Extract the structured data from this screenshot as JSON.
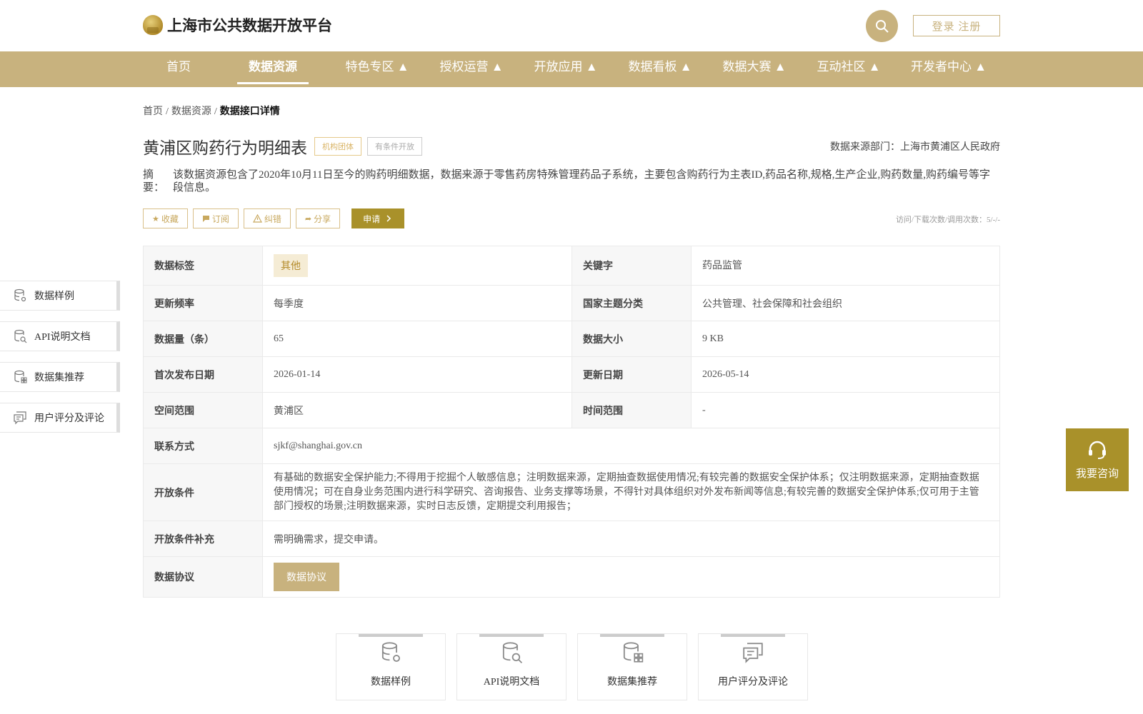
{
  "header": {
    "site_title": "上海市公共数据开放平台",
    "login_label": "登录 注册"
  },
  "nav": {
    "items": [
      {
        "label": "首页"
      },
      {
        "label": "数据资源"
      },
      {
        "label": "特色专区 ▲"
      },
      {
        "label": "授权运营 ▲"
      },
      {
        "label": "开放应用 ▲"
      },
      {
        "label": "数据看板 ▲"
      },
      {
        "label": "数据大赛 ▲"
      },
      {
        "label": "互动社区 ▲"
      },
      {
        "label": "开发者中心 ▲"
      }
    ]
  },
  "breadcrumb": {
    "home": "首页",
    "sep": "/",
    "section": "数据资源",
    "current": "数据接口详情"
  },
  "dataset": {
    "title": "黄浦区购药行为明细表",
    "tag_org": "机构团体",
    "tag_open": "有条件开放",
    "source": "数据来源部门：上海市黄浦区人民政府",
    "summary_label": "摘要：",
    "summary": "该数据资源包含了2020年10月11日至今的购药明细数据，数据来源于零售药房特殊管理药品子系统，主要包含购药行为主表ID,药品名称,规格,生产企业,购药数量,购药编号等字段信息。"
  },
  "actions": {
    "favorite": "收藏",
    "subscribe": "订阅",
    "report": "纠错",
    "share": "分享",
    "apply": "申请",
    "stats": "访问/下载次数/调用次数：5/-/-"
  },
  "info": {
    "tag_label": "数据标签",
    "tag_value": "其他",
    "keyword_label": "关键字",
    "keyword_value": "药品监管",
    "freq_label": "更新频率",
    "freq_value": "每季度",
    "theme_label": "国家主题分类",
    "theme_value": "公共管理、社会保障和社会组织",
    "count_label": "数据量（条）",
    "count_value": "65",
    "size_label": "数据大小",
    "size_value": "9 KB",
    "first_label": "首次发布日期",
    "first_value": "2026-01-14",
    "update_label": "更新日期",
    "update_value": "2026-05-14",
    "space_label": "空间范围",
    "space_value": "黄浦区",
    "time_label": "时间范围",
    "time_value": "-",
    "contact_label": "联系方式",
    "contact_value": "sjkf@shanghai.gov.cn",
    "cond_label": "开放条件",
    "cond_value": "有基础的数据安全保护能力;不得用于挖掘个人敏感信息；注明数据来源，定期抽查数据使用情况;有较完善的数据安全保护体系；仅注明数据来源，定期抽查数据使用情况；可在自身业务范围内进行科学研究、咨询报告、业务支撑等场景，不得针对具体组织对外发布新闻等信息;有较完善的数据安全保护体系;仅可用于主管部门授权的场景;注明数据来源，实时日志反馈，定期提交利用报告；",
    "cond_extra_label": "开放条件补充",
    "cond_extra_value": "需明确需求，提交申请。",
    "protocol_label": "数据协议",
    "protocol_button": "数据协议"
  },
  "side_menu": {
    "items": [
      {
        "label": "数据样例"
      },
      {
        "label": "API说明文档"
      },
      {
        "label": "数据集推荐"
      },
      {
        "label": "用户评分及评论"
      }
    ]
  },
  "consult": {
    "label": "我要咨询"
  },
  "bottom_cards": {
    "items": [
      {
        "label": "数据样例"
      },
      {
        "label": "API说明文档"
      },
      {
        "label": "数据集推荐"
      },
      {
        "label": "用户评分及评论"
      }
    ]
  },
  "colors": {
    "gold": "#c8b27e",
    "dark_gold": "#a9912a"
  }
}
